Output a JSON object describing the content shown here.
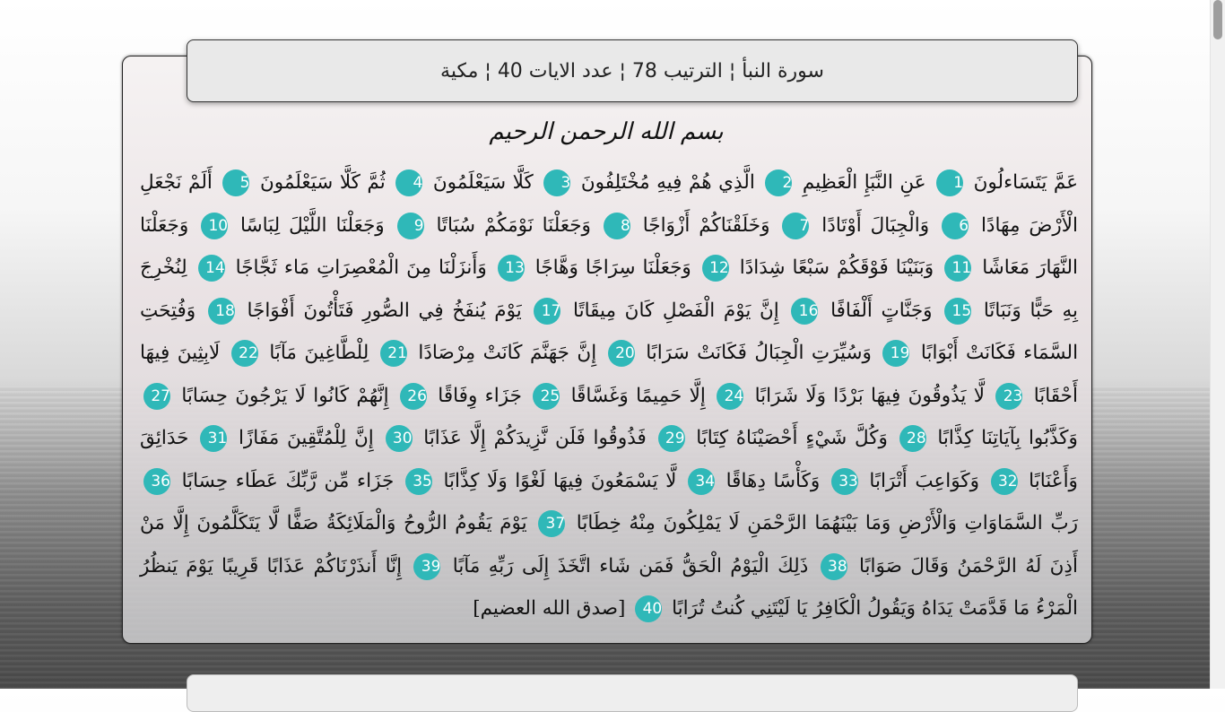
{
  "header": {
    "info": "سورة النبأ ¦ الترتيب 78 ¦ عدد الايات 40 ¦ مكية"
  },
  "basmala": "بسم الله الرحمن الرحيم",
  "closing": "[صدق الله العضيم]",
  "verses": [
    {
      "n": "1",
      "t": "عَمَّ يَتَسَاءلُونَ"
    },
    {
      "n": "2",
      "t": "عَنِ النَّبَإِ الْعَظِيمِ"
    },
    {
      "n": "3",
      "t": "الَّذِي هُمْ فِيهِ مُخْتَلِفُونَ"
    },
    {
      "n": "4",
      "t": "كَلَّا سَيَعْلَمُونَ"
    },
    {
      "n": "5",
      "t": "ثُمَّ كَلَّا سَيَعْلَمُونَ"
    },
    {
      "n": "6",
      "t": "أَلَمْ نَجْعَلِ الْأَرْضَ مِهَادًا"
    },
    {
      "n": "7",
      "t": "وَالْجِبَالَ أَوْتَادًا"
    },
    {
      "n": "8",
      "t": "وَخَلَقْنَاكُمْ أَزْوَاجًا"
    },
    {
      "n": "9",
      "t": "وَجَعَلْنَا نَوْمَكُمْ سُبَاتًا"
    },
    {
      "n": "10",
      "t": "وَجَعَلْنَا اللَّيْلَ لِبَاسًا"
    },
    {
      "n": "11",
      "t": "وَجَعَلْنَا النَّهَارَ مَعَاشًا"
    },
    {
      "n": "12",
      "t": "وَبَنَيْنَا فَوْقَكُمْ سَبْعًا شِدَادًا"
    },
    {
      "n": "13",
      "t": "وَجَعَلْنَا سِرَاجًا وَهَّاجًا"
    },
    {
      "n": "14",
      "t": "وَأَنزَلْنَا مِنَ الْمُعْصِرَاتِ مَاء ثَجَّاجًا"
    },
    {
      "n": "15",
      "t": "لِنُخْرِجَ بِهِ حَبًّا وَنَبَاتًا"
    },
    {
      "n": "16",
      "t": "وَجَنَّاتٍ أَلْفَافًا"
    },
    {
      "n": "17",
      "t": "إِنَّ يَوْمَ الْفَصْلِ كَانَ مِيقَاتًا"
    },
    {
      "n": "18",
      "t": "يَوْمَ يُنفَخُ فِي الصُّورِ فَتَأْتُونَ أَفْوَاجًا"
    },
    {
      "n": "19",
      "t": "وَفُتِحَتِ السَّمَاء فَكَانَتْ أَبْوَابًا"
    },
    {
      "n": "20",
      "t": "وَسُيِّرَتِ الْجِبَالُ فَكَانَتْ سَرَابًا"
    },
    {
      "n": "21",
      "t": "إِنَّ جَهَنَّمَ كَانَتْ مِرْصَادًا"
    },
    {
      "n": "22",
      "t": "لِلْطَّاغِينَ مَآبًا"
    },
    {
      "n": "23",
      "t": "لَابِثِينَ فِيهَا أَحْقَابًا"
    },
    {
      "n": "24",
      "t": "لَّا يَذُوقُونَ فِيهَا بَرْدًا وَلَا شَرَابًا"
    },
    {
      "n": "25",
      "t": "إِلَّا حَمِيمًا وَغَسَّاقًا"
    },
    {
      "n": "26",
      "t": "جَزَاء وِفَاقًا"
    },
    {
      "n": "27",
      "t": "إِنَّهُمْ كَانُوا لَا يَرْجُونَ حِسَابًا"
    },
    {
      "n": "28",
      "t": "وَكَذَّبُوا بِآيَاتِنَا كِذَّابًا"
    },
    {
      "n": "29",
      "t": "وَكُلَّ شَيْءٍ أَحْصَيْنَاهُ كِتَابًا"
    },
    {
      "n": "30",
      "t": "فَذُوقُوا فَلَن نَّزِيدَكُمْ إِلَّا عَذَابًا"
    },
    {
      "n": "31",
      "t": "إِنَّ لِلْمُتَّقِينَ مَفَازًا"
    },
    {
      "n": "32",
      "t": "حَدَائِقَ وَأَعْنَابًا"
    },
    {
      "n": "33",
      "t": "وَكَوَاعِبَ أَتْرَابًا"
    },
    {
      "n": "34",
      "t": "وَكَأْسًا دِهَاقًا"
    },
    {
      "n": "35",
      "t": "لَّا يَسْمَعُونَ فِيهَا لَغْوًا وَلَا كِذَّابًا"
    },
    {
      "n": "36",
      "t": "جَزَاء مِّن رَّبِّكَ عَطَاء حِسَابًا"
    },
    {
      "n": "37",
      "t": "رَبِّ السَّمَاوَاتِ وَالْأَرْضِ وَمَا بَيْنَهُمَا الرَّحْمَنِ لَا يَمْلِكُونَ مِنْهُ خِطَابًا"
    },
    {
      "n": "38",
      "t": "يَوْمَ يَقُومُ الرُّوحُ وَالْمَلَائِكَةُ صَفًّا لَّا يَتَكَلَّمُونَ إِلَّا مَنْ أَذِنَ لَهُ الرَّحْمَنُ وَقَالَ صَوَابًا"
    },
    {
      "n": "39",
      "t": "ذَلِكَ الْيَوْمُ الْحَقُّ فَمَن شَاء اتَّخَذَ إِلَى رَبِّهِ مَآبًا"
    },
    {
      "n": "40",
      "t": "إِنَّا أَنذَرْنَاكُمْ عَذَابًا قَرِيبًا يَوْمَ يَنظُرُ الْمَرْءُ مَا قَدَّمَتْ يَدَاهُ وَيَقُولُ الْكَافِرُ يَا لَيْتَنِي كُنتُ تُرَابًا"
    }
  ]
}
